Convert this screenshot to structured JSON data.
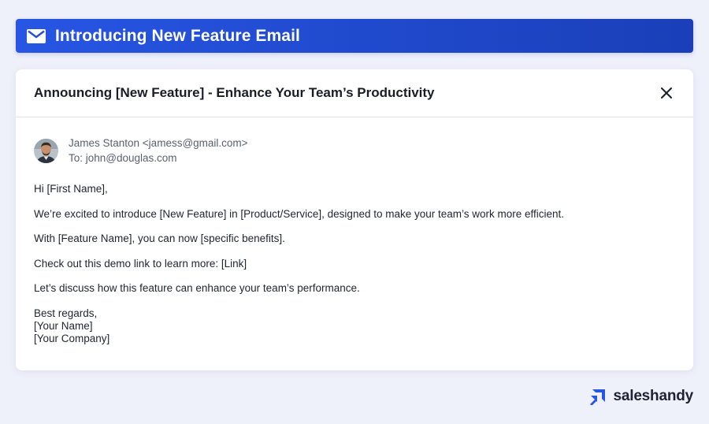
{
  "banner": {
    "icon": "mail-icon",
    "title": "Introducing New Feature Email"
  },
  "email": {
    "subject": "Announcing [New Feature] - Enhance Your Team’s Productivity",
    "close_icon": "close-icon",
    "sender": "James Stanton <jamess@gmail.com>",
    "recipient": "To: john@douglas.com",
    "body": {
      "greeting": "Hi [First Name],",
      "paragraphs": [
        "We’re excited to introduce [New Feature] in [Product/Service], designed to make your team’s work more efficient.",
        "With [Feature Name], you can now [specific benefits].",
        "Check out this demo link to learn more: [Link]",
        "Let’s discuss how this feature can enhance your team’s performance."
      ],
      "signoff": [
        "Best regards,",
        "[Your Name]",
        "[Your Company]"
      ]
    }
  },
  "brand": {
    "name": "saleshandy",
    "color": "#2457e6"
  }
}
